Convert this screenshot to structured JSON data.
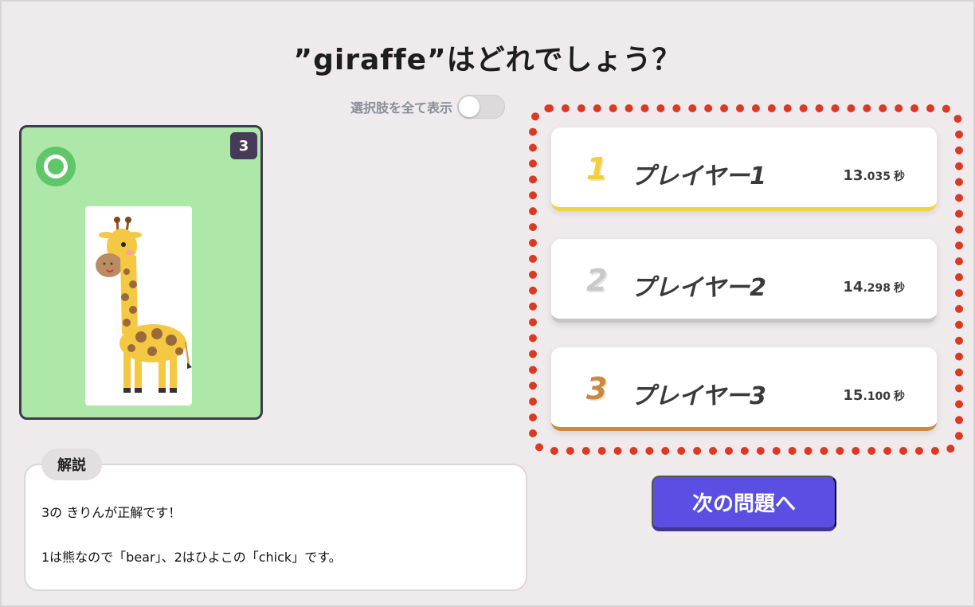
{
  "question": {
    "title": "”giraffe”はどれでしょう？"
  },
  "toggle": {
    "label": "選択肢を全て表示",
    "on": false
  },
  "card": {
    "number": "3",
    "correct": true,
    "image_icon": "giraffe-illustration",
    "background_color": "#aee8a8"
  },
  "explanation": {
    "tab_label": "解説",
    "line1": "3の きりんが正解です！",
    "line2": "1は熊なので「bear」、2はひよこの「chick」です。"
  },
  "ranking": [
    {
      "rank": "1",
      "name": "プレイヤー1",
      "seconds": "13",
      "fraction": ".035",
      "unit": "秒",
      "color": "#f2d23d"
    },
    {
      "rank": "2",
      "name": "プレイヤー2",
      "seconds": "14",
      "fraction": ".298",
      "unit": "秒",
      "color": "#c9c5c6"
    },
    {
      "rank": "3",
      "name": "プレイヤー3",
      "seconds": "15",
      "fraction": ".100",
      "unit": "秒",
      "color": "#c98a45"
    }
  ],
  "next_button": {
    "label": "次の問題へ"
  },
  "colors": {
    "accent": "#5b4fe3",
    "highlight": "#d93a25",
    "correct": "#5fc76a"
  }
}
